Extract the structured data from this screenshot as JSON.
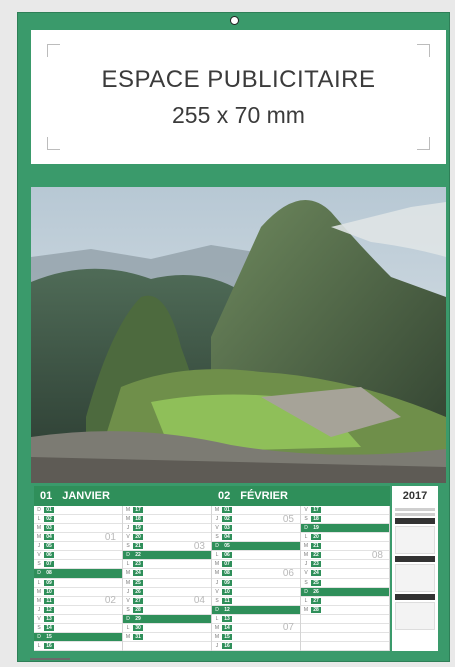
{
  "ad": {
    "title": "ESPACE PUBLICITAIRE",
    "size": "255 x 70 mm"
  },
  "calendar": {
    "year": "2017",
    "months": [
      {
        "num": "01",
        "name": "JANVIER",
        "weeks": [
          "01",
          "02",
          "03",
          "04"
        ]
      },
      {
        "num": "02",
        "name": "FÉVRIER",
        "weeks": [
          "05",
          "06",
          "07",
          "08"
        ]
      }
    ]
  }
}
